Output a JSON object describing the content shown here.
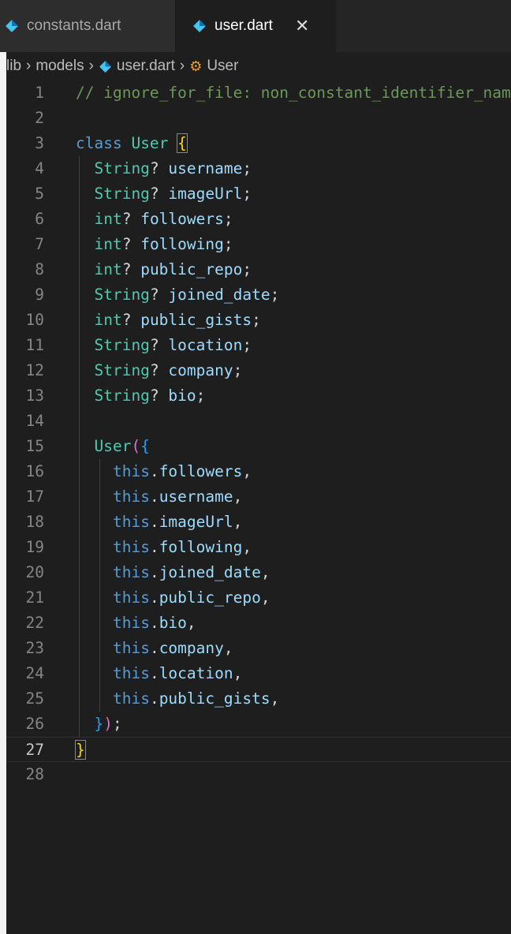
{
  "tabs": [
    {
      "label": "constants.dart",
      "active": false
    },
    {
      "label": "user.dart",
      "active": true
    }
  ],
  "breadcrumb": [
    "lib",
    "models",
    "user.dart",
    "User"
  ],
  "colors": {
    "background": "#1e1e1e",
    "comment": "#6a9955",
    "keyword": "#569cd6",
    "type": "#4ec9b0",
    "identifier": "#9cdcfe",
    "bracket_gold": "#ffd700",
    "bracket_violet": "#da70d6",
    "bracket_blue": "#179fff",
    "line_number": "#858585"
  },
  "current_line": 27,
  "lines": [
    {
      "num": "1",
      "tokens": [
        {
          "t": "// ignore_for_file: non_constant_identifier_names",
          "c": "comment"
        }
      ]
    },
    {
      "num": "2",
      "tokens": []
    },
    {
      "num": "3",
      "tokens": [
        {
          "t": "class",
          "c": "kw"
        },
        {
          "t": " ",
          "c": "punct"
        },
        {
          "t": "User",
          "c": "type"
        },
        {
          "t": " ",
          "c": "punct"
        },
        {
          "t": "{",
          "c": "brace",
          "hl": true
        }
      ]
    },
    {
      "num": "4",
      "tokens": [
        {
          "t": "  "
        },
        {
          "t": "String",
          "c": "type"
        },
        {
          "t": "? ",
          "c": "punct"
        },
        {
          "t": "username",
          "c": "ident"
        },
        {
          "t": ";",
          "c": "punct"
        }
      ]
    },
    {
      "num": "5",
      "tokens": [
        {
          "t": "  "
        },
        {
          "t": "String",
          "c": "type"
        },
        {
          "t": "? ",
          "c": "punct"
        },
        {
          "t": "imageUrl",
          "c": "ident"
        },
        {
          "t": ";",
          "c": "punct"
        }
      ]
    },
    {
      "num": "6",
      "tokens": [
        {
          "t": "  "
        },
        {
          "t": "int",
          "c": "type"
        },
        {
          "t": "? ",
          "c": "punct"
        },
        {
          "t": "followers",
          "c": "ident"
        },
        {
          "t": ";",
          "c": "punct"
        }
      ]
    },
    {
      "num": "7",
      "tokens": [
        {
          "t": "  "
        },
        {
          "t": "int",
          "c": "type"
        },
        {
          "t": "? ",
          "c": "punct"
        },
        {
          "t": "following",
          "c": "ident"
        },
        {
          "t": ";",
          "c": "punct"
        }
      ]
    },
    {
      "num": "8",
      "tokens": [
        {
          "t": "  "
        },
        {
          "t": "int",
          "c": "type"
        },
        {
          "t": "? ",
          "c": "punct"
        },
        {
          "t": "public_repo",
          "c": "ident"
        },
        {
          "t": ";",
          "c": "punct"
        }
      ]
    },
    {
      "num": "9",
      "tokens": [
        {
          "t": "  "
        },
        {
          "t": "String",
          "c": "type"
        },
        {
          "t": "? ",
          "c": "punct"
        },
        {
          "t": "joined_date",
          "c": "ident"
        },
        {
          "t": ";",
          "c": "punct"
        }
      ]
    },
    {
      "num": "10",
      "tokens": [
        {
          "t": "  "
        },
        {
          "t": "int",
          "c": "type"
        },
        {
          "t": "? ",
          "c": "punct"
        },
        {
          "t": "public_gists",
          "c": "ident"
        },
        {
          "t": ";",
          "c": "punct"
        }
      ]
    },
    {
      "num": "11",
      "tokens": [
        {
          "t": "  "
        },
        {
          "t": "String",
          "c": "type"
        },
        {
          "t": "? ",
          "c": "punct"
        },
        {
          "t": "location",
          "c": "ident"
        },
        {
          "t": ";",
          "c": "punct"
        }
      ]
    },
    {
      "num": "12",
      "tokens": [
        {
          "t": "  "
        },
        {
          "t": "String",
          "c": "type"
        },
        {
          "t": "? ",
          "c": "punct"
        },
        {
          "t": "company",
          "c": "ident"
        },
        {
          "t": ";",
          "c": "punct"
        }
      ]
    },
    {
      "num": "13",
      "tokens": [
        {
          "t": "  "
        },
        {
          "t": "String",
          "c": "type"
        },
        {
          "t": "? ",
          "c": "punct"
        },
        {
          "t": "bio",
          "c": "ident"
        },
        {
          "t": ";",
          "c": "punct"
        }
      ]
    },
    {
      "num": "14",
      "tokens": []
    },
    {
      "num": "15",
      "tokens": [
        {
          "t": "  "
        },
        {
          "t": "User",
          "c": "type"
        },
        {
          "t": "(",
          "c": "brace2"
        },
        {
          "t": "{",
          "c": "brace3"
        }
      ]
    },
    {
      "num": "16",
      "tokens": [
        {
          "t": "    "
        },
        {
          "t": "this",
          "c": "kw"
        },
        {
          "t": ".",
          "c": "punct"
        },
        {
          "t": "followers",
          "c": "ident"
        },
        {
          "t": ",",
          "c": "punct"
        }
      ]
    },
    {
      "num": "17",
      "tokens": [
        {
          "t": "    "
        },
        {
          "t": "this",
          "c": "kw"
        },
        {
          "t": ".",
          "c": "punct"
        },
        {
          "t": "username",
          "c": "ident"
        },
        {
          "t": ",",
          "c": "punct"
        }
      ]
    },
    {
      "num": "18",
      "tokens": [
        {
          "t": "    "
        },
        {
          "t": "this",
          "c": "kw"
        },
        {
          "t": ".",
          "c": "punct"
        },
        {
          "t": "imageUrl",
          "c": "ident"
        },
        {
          "t": ",",
          "c": "punct"
        }
      ]
    },
    {
      "num": "19",
      "tokens": [
        {
          "t": "    "
        },
        {
          "t": "this",
          "c": "kw"
        },
        {
          "t": ".",
          "c": "punct"
        },
        {
          "t": "following",
          "c": "ident"
        },
        {
          "t": ",",
          "c": "punct"
        }
      ]
    },
    {
      "num": "20",
      "tokens": [
        {
          "t": "    "
        },
        {
          "t": "this",
          "c": "kw"
        },
        {
          "t": ".",
          "c": "punct"
        },
        {
          "t": "joined_date",
          "c": "ident"
        },
        {
          "t": ",",
          "c": "punct"
        }
      ]
    },
    {
      "num": "21",
      "tokens": [
        {
          "t": "    "
        },
        {
          "t": "this",
          "c": "kw"
        },
        {
          "t": ".",
          "c": "punct"
        },
        {
          "t": "public_repo",
          "c": "ident"
        },
        {
          "t": ",",
          "c": "punct"
        }
      ]
    },
    {
      "num": "22",
      "tokens": [
        {
          "t": "    "
        },
        {
          "t": "this",
          "c": "kw"
        },
        {
          "t": ".",
          "c": "punct"
        },
        {
          "t": "bio",
          "c": "ident"
        },
        {
          "t": ",",
          "c": "punct"
        }
      ]
    },
    {
      "num": "23",
      "tokens": [
        {
          "t": "    "
        },
        {
          "t": "this",
          "c": "kw"
        },
        {
          "t": ".",
          "c": "punct"
        },
        {
          "t": "company",
          "c": "ident"
        },
        {
          "t": ",",
          "c": "punct"
        }
      ]
    },
    {
      "num": "24",
      "tokens": [
        {
          "t": "    "
        },
        {
          "t": "this",
          "c": "kw"
        },
        {
          "t": ".",
          "c": "punct"
        },
        {
          "t": "location",
          "c": "ident"
        },
        {
          "t": ",",
          "c": "punct"
        }
      ]
    },
    {
      "num": "25",
      "tokens": [
        {
          "t": "    "
        },
        {
          "t": "this",
          "c": "kw"
        },
        {
          "t": ".",
          "c": "punct"
        },
        {
          "t": "public_gists",
          "c": "ident"
        },
        {
          "t": ",",
          "c": "punct"
        }
      ]
    },
    {
      "num": "26",
      "tokens": [
        {
          "t": "  "
        },
        {
          "t": "}",
          "c": "brace3"
        },
        {
          "t": ")",
          "c": "brace2"
        },
        {
          "t": ";",
          "c": "punct"
        }
      ]
    },
    {
      "num": "27",
      "tokens": [
        {
          "t": "}",
          "c": "brace",
          "hl": true
        }
      ]
    },
    {
      "num": "28",
      "tokens": []
    }
  ]
}
